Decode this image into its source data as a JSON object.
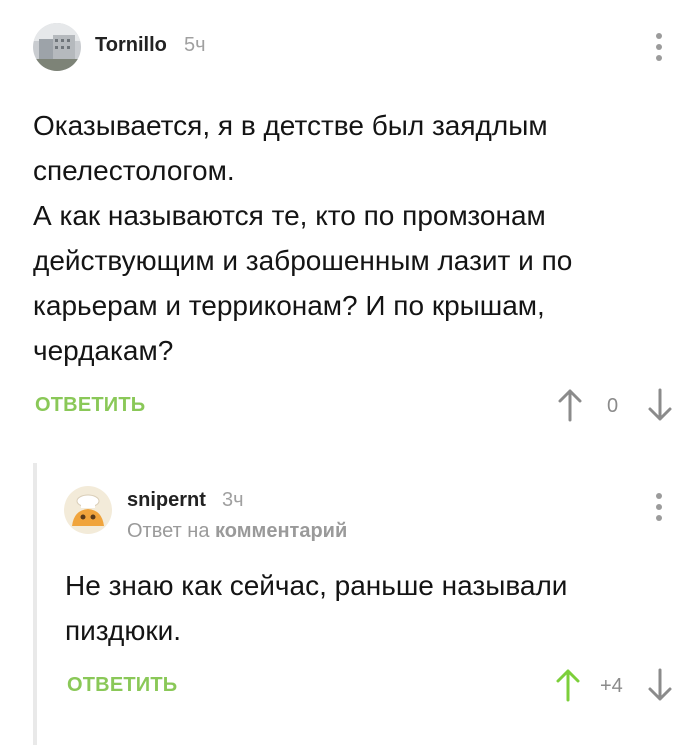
{
  "comment1": {
    "author": "Tornillo",
    "time": "5ч",
    "text_lines": [
      "Оказывается, я в детстве был заядлым",
      "спелестологом.",
      "А как называются те, кто по промзонам",
      "действующим и заброшенным лазит и по",
      "карьерам и терриконам? И по крышам,",
      "чердакам?"
    ],
    "reply_label": "ОТВЕТИТЬ",
    "score": "0",
    "icons": {
      "more": "more-vertical-icon",
      "upvote": "arrow-up-icon",
      "downvote": "arrow-down-icon"
    }
  },
  "comment2": {
    "author": "snipernt",
    "time": "3ч",
    "reply_to_prefix": "Ответ на",
    "reply_to_link": "комментарий",
    "text_lines": [
      "Не знаю как сейчас, раньше называли",
      "пиздюки."
    ],
    "reply_label": "ОТВЕТИТЬ",
    "score": "+4",
    "icons": {
      "more": "more-vertical-icon",
      "upvote": "arrow-up-icon",
      "downvote": "arrow-down-icon"
    }
  },
  "colors": {
    "accent_green": "#8ac858",
    "muted": "#9b9b9b",
    "thread_line": "#e9e9e9"
  }
}
